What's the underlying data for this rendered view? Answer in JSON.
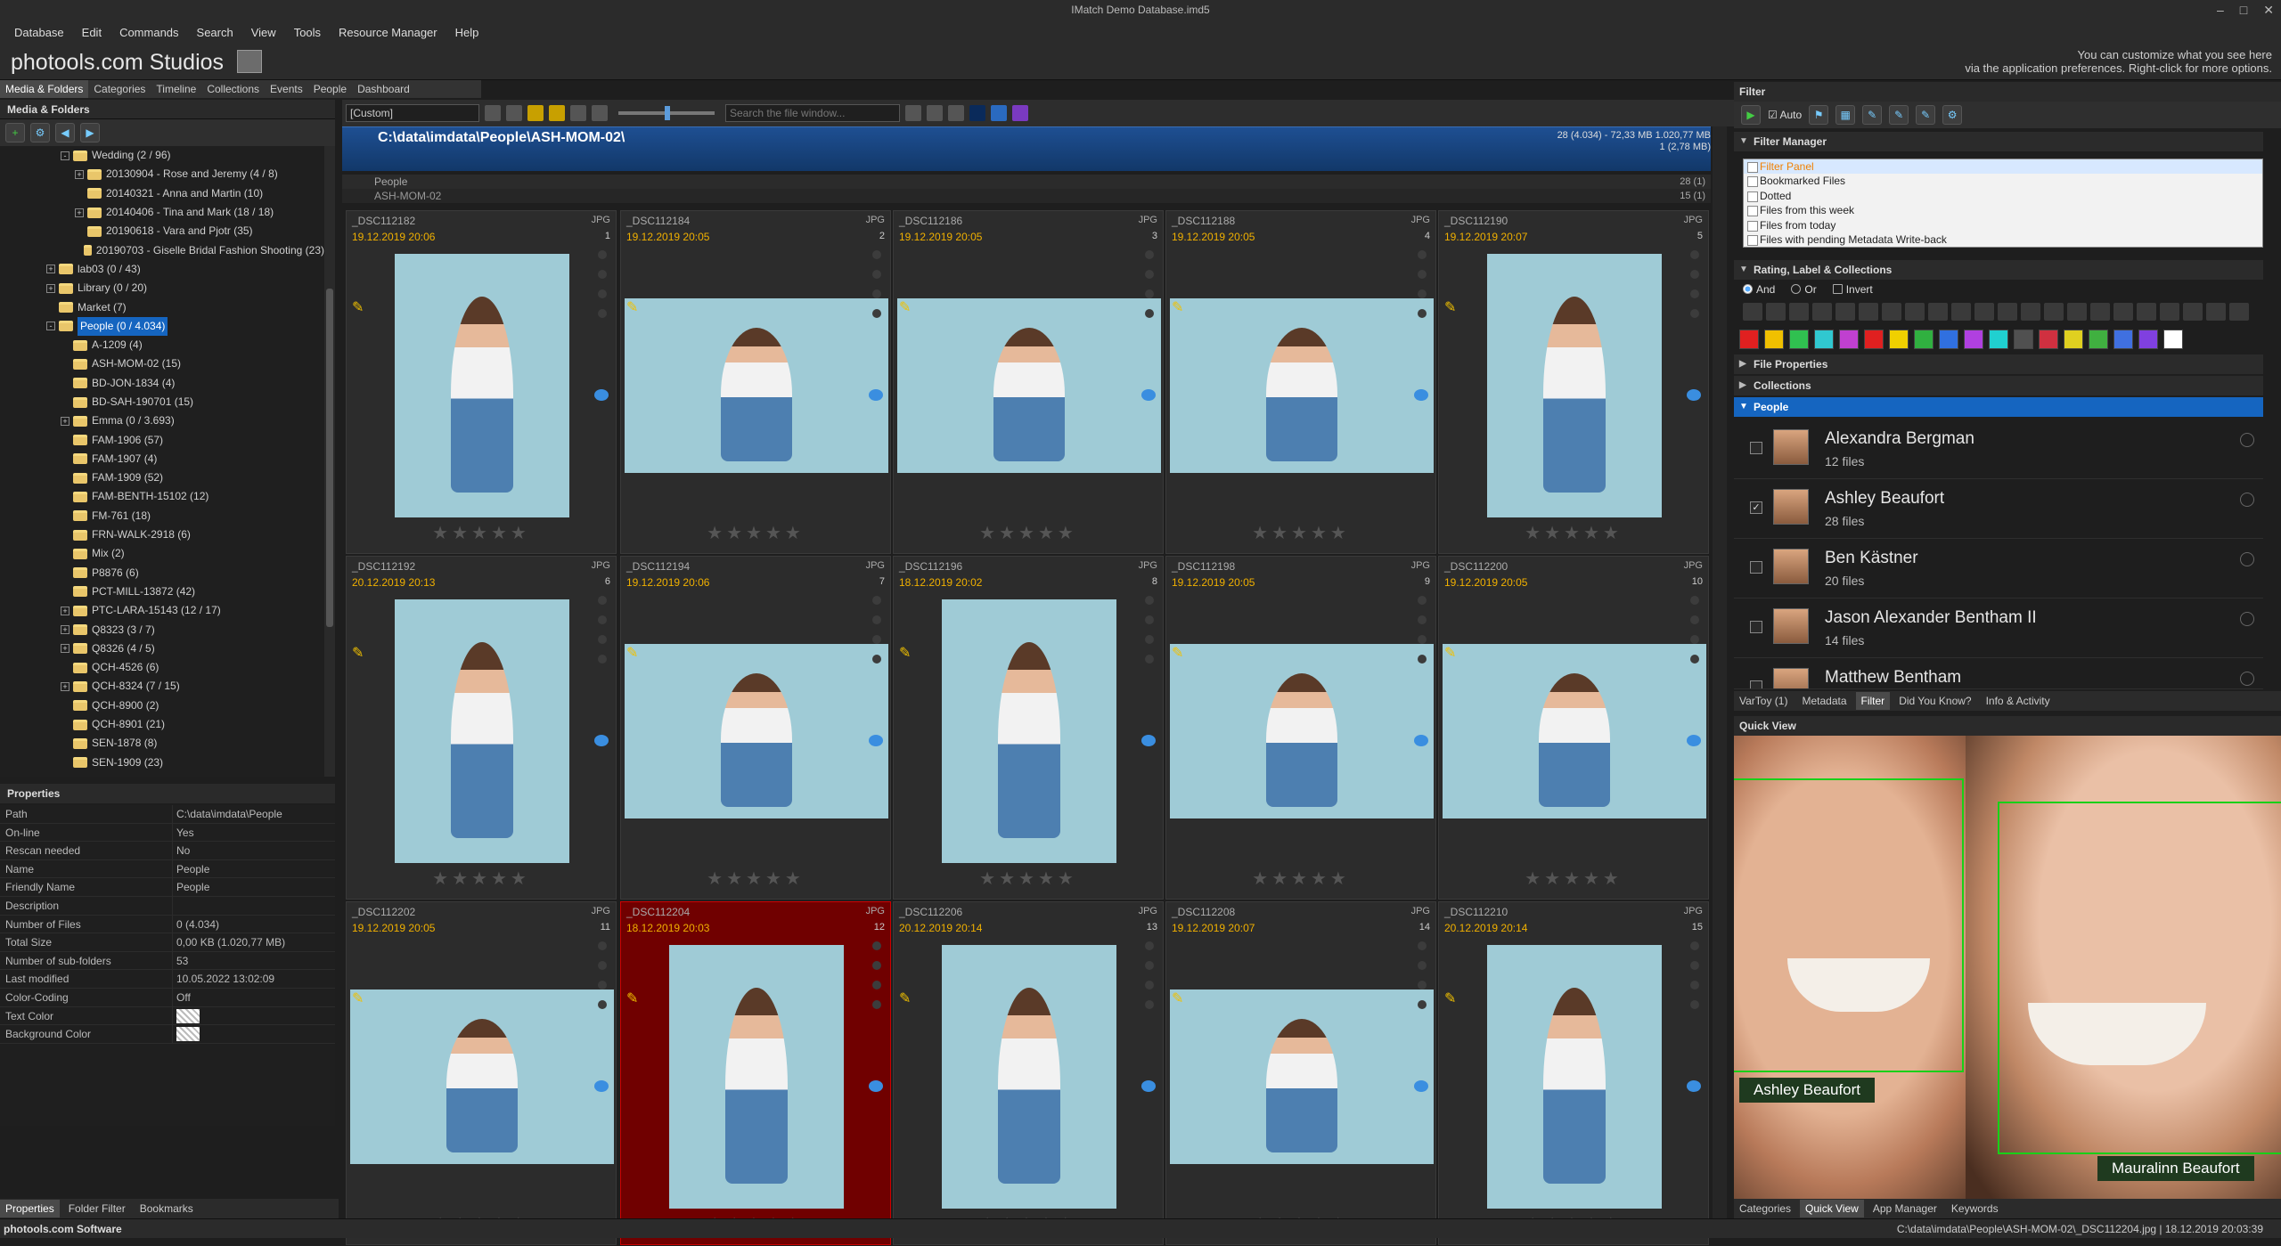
{
  "window": {
    "title": "IMatch Demo Database.imd5"
  },
  "menu": [
    "Database",
    "Edit",
    "Commands",
    "Search",
    "View",
    "Tools",
    "Resource Manager",
    "Help"
  ],
  "brand": {
    "name": "photools.com Studios",
    "hint_line1": "You can customize what you see here",
    "hint_line2": "via the application preferences. Right-click for more options."
  },
  "left_tabs": [
    "Media & Folders",
    "Categories",
    "Timeline",
    "Collections",
    "Events",
    "People",
    "Dashboard"
  ],
  "left_panel": {
    "title": "Media & Folders"
  },
  "tree": [
    {
      "label": "Wedding (2 / 96)",
      "level": 2,
      "exp": "-"
    },
    {
      "label": "20130904 - Rose and Jeremy (4 / 8)",
      "level": 3,
      "exp": "+"
    },
    {
      "label": "20140321 - Anna and Martin (10)",
      "level": 3,
      "exp": ""
    },
    {
      "label": "20140406 - Tina and Mark (18 / 18)",
      "level": 3,
      "exp": "+"
    },
    {
      "label": "20190618 - Vara and Pjotr (35)",
      "level": 3,
      "exp": ""
    },
    {
      "label": "20190703 - Giselle Bridal Fashion Shooting (23)",
      "level": 3,
      "exp": ""
    },
    {
      "label": "lab03 (0 / 43)",
      "level": 1,
      "exp": "+"
    },
    {
      "label": "Library (0 / 20)",
      "level": 1,
      "exp": "+"
    },
    {
      "label": "Market (7)",
      "level": 1,
      "exp": ""
    },
    {
      "label": "People (0 / 4.034)",
      "level": 1,
      "exp": "-",
      "selected": true
    },
    {
      "label": "A-1209 (4)",
      "level": 2,
      "exp": ""
    },
    {
      "label": "ASH-MOM-02 (15)",
      "level": 2,
      "exp": ""
    },
    {
      "label": "BD-JON-1834 (4)",
      "level": 2,
      "exp": ""
    },
    {
      "label": "BD-SAH-190701 (15)",
      "level": 2,
      "exp": ""
    },
    {
      "label": "Emma (0 / 3.693)",
      "level": 2,
      "exp": "+"
    },
    {
      "label": "FAM-1906 (57)",
      "level": 2,
      "exp": ""
    },
    {
      "label": "FAM-1907 (4)",
      "level": 2,
      "exp": ""
    },
    {
      "label": "FAM-1909 (52)",
      "level": 2,
      "exp": ""
    },
    {
      "label": "FAM-BENTH-15102 (12)",
      "level": 2,
      "exp": ""
    },
    {
      "label": "FM-761 (18)",
      "level": 2,
      "exp": ""
    },
    {
      "label": "FRN-WALK-2918 (6)",
      "level": 2,
      "exp": ""
    },
    {
      "label": "Mix (2)",
      "level": 2,
      "exp": ""
    },
    {
      "label": "P8876 (6)",
      "level": 2,
      "exp": ""
    },
    {
      "label": "PCT-MILL-13872 (42)",
      "level": 2,
      "exp": ""
    },
    {
      "label": "PTC-LARA-15143 (12 / 17)",
      "level": 2,
      "exp": "+"
    },
    {
      "label": "Q8323 (3 / 7)",
      "level": 2,
      "exp": "+"
    },
    {
      "label": "Q8326 (4 / 5)",
      "level": 2,
      "exp": "+"
    },
    {
      "label": "QCH-4526 (6)",
      "level": 2,
      "exp": ""
    },
    {
      "label": "QCH-8324 (7 / 15)",
      "level": 2,
      "exp": "+"
    },
    {
      "label": "QCH-8900 (2)",
      "level": 2,
      "exp": ""
    },
    {
      "label": "QCH-8901 (21)",
      "level": 2,
      "exp": ""
    },
    {
      "label": "SEN-1878 (8)",
      "level": 2,
      "exp": ""
    },
    {
      "label": "SEN-1909 (23)",
      "level": 2,
      "exp": ""
    }
  ],
  "properties": {
    "title": "Properties",
    "rows": [
      {
        "k": "Path",
        "v": "C:\\data\\imdata\\People"
      },
      {
        "k": "On-line",
        "v": "Yes"
      },
      {
        "k": "Rescan needed",
        "v": "No"
      },
      {
        "k": "Name",
        "v": "People"
      },
      {
        "k": "Friendly Name",
        "v": "People"
      },
      {
        "k": "Description",
        "v": ""
      },
      {
        "k": "Number of Files",
        "v": "0 (4.034)"
      },
      {
        "k": "Total Size",
        "v": "0,00 KB (1.020,77 MB)"
      },
      {
        "k": "Number of sub-folders",
        "v": "53"
      },
      {
        "k": "Last modified",
        "v": "10.05.2022 13:02:09"
      },
      {
        "k": "Color-Coding",
        "v": "Off"
      },
      {
        "k": "Text Color",
        "v": ""
      },
      {
        "k": "Background Color",
        "v": ""
      }
    ]
  },
  "left_bottom_tabs": [
    "Properties",
    "Folder Filter",
    "Bookmarks"
  ],
  "file_window": {
    "layout_combo": "[Custom]",
    "search_placeholder": "Search the file window...",
    "path": "C:\\data\\imdata\\People\\ASH-MOM-02\\",
    "info_line1": "28 (4.034) - 72,33 MB 1.020,77 MB",
    "info_line2": "1 (2,78 MB)",
    "group1": "People",
    "group1_count": "28 (1)",
    "group2": "ASH-MOM-02",
    "group2_count": "15 (1)"
  },
  "thumbs": [
    {
      "name": "_DSC112182",
      "ext": "JPG",
      "date": "19.12.2019 20:06",
      "num": "1"
    },
    {
      "name": "_DSC112184",
      "ext": "JPG",
      "date": "19.12.2019 20:05",
      "num": "2"
    },
    {
      "name": "_DSC112186",
      "ext": "JPG",
      "date": "19.12.2019 20:05",
      "num": "3"
    },
    {
      "name": "_DSC112188",
      "ext": "JPG",
      "date": "19.12.2019 20:05",
      "num": "4"
    },
    {
      "name": "_DSC112190",
      "ext": "JPG",
      "date": "19.12.2019 20:07",
      "num": "5"
    },
    {
      "name": "_DSC112192",
      "ext": "JPG",
      "date": "20.12.2019 20:13",
      "num": "6"
    },
    {
      "name": "_DSC112194",
      "ext": "JPG",
      "date": "19.12.2019 20:06",
      "num": "7"
    },
    {
      "name": "_DSC112196",
      "ext": "JPG",
      "date": "18.12.2019 20:02",
      "num": "8"
    },
    {
      "name": "_DSC112198",
      "ext": "JPG",
      "date": "19.12.2019 20:05",
      "num": "9"
    },
    {
      "name": "_DSC112200",
      "ext": "JPG",
      "date": "19.12.2019 20:05",
      "num": "10"
    },
    {
      "name": "_DSC112202",
      "ext": "JPG",
      "date": "19.12.2019 20:05",
      "num": "11"
    },
    {
      "name": "_DSC112204",
      "ext": "JPG",
      "date": "18.12.2019 20:03",
      "num": "12",
      "highlight": true
    },
    {
      "name": "_DSC112206",
      "ext": "JPG",
      "date": "20.12.2019 20:14",
      "num": "13"
    },
    {
      "name": "_DSC112208",
      "ext": "JPG",
      "date": "19.12.2019 20:07",
      "num": "14"
    },
    {
      "name": "_DSC112210",
      "ext": "JPG",
      "date": "20.12.2019 20:14",
      "num": "15"
    }
  ],
  "filter": {
    "title": "Filter",
    "auto_label": "Auto",
    "manager_title": "Filter Manager",
    "manager_items": [
      "Filter Panel",
      "Bookmarked Files",
      "Dotted",
      "Files from this week",
      "Files from today",
      "Files with pending Metadata Write-back"
    ],
    "rlc_title": "Rating, Label & Collections",
    "logic": [
      "And",
      "Or",
      "Invert"
    ],
    "file_props_title": "File Properties",
    "collections_title": "Collections",
    "people_title": "People",
    "label_colors": [
      "#e02020",
      "#f0c000",
      "#30c050",
      "#30c8d0",
      "#c040d0",
      "#e02020",
      "#f0d000",
      "#30b040",
      "#3070e0",
      "#b040e0",
      "#20d0d0",
      "#505050",
      "#d03040",
      "#e0d020",
      "#40b040",
      "#4070e0",
      "#8040e0",
      "#ffffff"
    ],
    "people": [
      {
        "name": "Alexandra Bergman",
        "files": "12 files",
        "checked": false
      },
      {
        "name": "Ashley Beaufort",
        "files": "28 files",
        "checked": true
      },
      {
        "name": "Ben Kästner",
        "files": "20 files",
        "checked": false
      },
      {
        "name": "Jason Alexander Bentham II",
        "files": "14 files",
        "checked": false
      },
      {
        "name": "Matthew Bentham",
        "files": "",
        "checked": false
      }
    ]
  },
  "right_tabs": [
    "VarToy (1)",
    "Metadata",
    "Filter",
    "Did You Know?",
    "Info & Activity"
  ],
  "quick_view": {
    "title": "Quick View",
    "face1": "Ashley Beaufort",
    "face2": "Mauralinn Beaufort"
  },
  "qv_tabs": [
    "Categories",
    "Quick View",
    "App Manager",
    "Keywords"
  ],
  "status": {
    "left": "photools.com Software",
    "right": "C:\\data\\imdata\\People\\ASH-MOM-02\\_DSC112204.jpg | 18.12.2019 20:03:39"
  }
}
